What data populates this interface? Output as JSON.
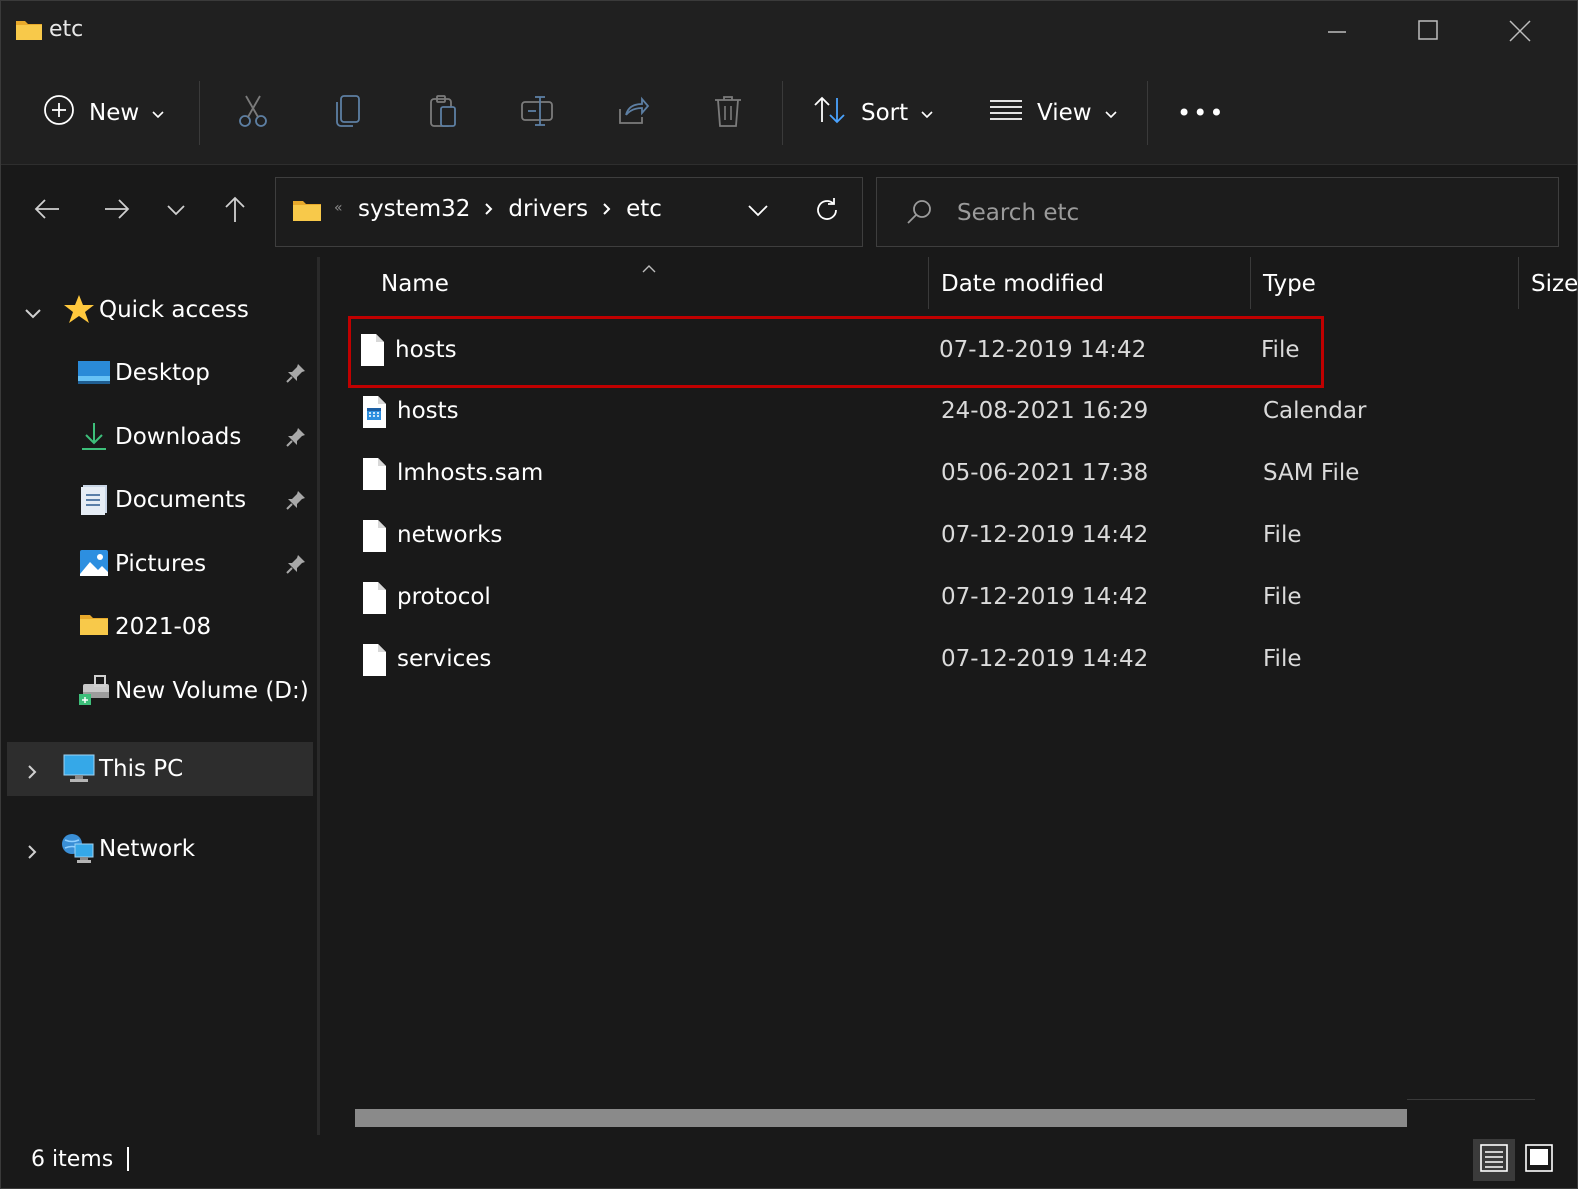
{
  "window": {
    "title": "etc"
  },
  "toolbar": {
    "new_label": "New",
    "sort_label": "Sort",
    "view_label": "View",
    "more_label": "•••"
  },
  "address": {
    "crumbs": [
      "system32",
      "drivers",
      "etc"
    ],
    "overflow_marker": "«"
  },
  "search": {
    "placeholder": "Search etc"
  },
  "sidebar": {
    "items": [
      {
        "label": "Quick access",
        "icon": "star-icon",
        "expanded": true
      },
      {
        "label": "Desktop",
        "icon": "desktop-icon",
        "pinned": true
      },
      {
        "label": "Downloads",
        "icon": "download-icon",
        "pinned": true
      },
      {
        "label": "Documents",
        "icon": "documents-icon",
        "pinned": true
      },
      {
        "label": "Pictures",
        "icon": "pictures-icon",
        "pinned": true
      },
      {
        "label": "2021-08",
        "icon": "folder-icon",
        "pinned": false
      },
      {
        "label": "New Volume (D:)",
        "icon": "drive-icon",
        "pinned": false
      },
      {
        "label": "This PC",
        "icon": "computer-icon",
        "selected": true
      },
      {
        "label": "Network",
        "icon": "network-icon"
      }
    ]
  },
  "columns": {
    "name": "Name",
    "date": "Date modified",
    "type": "Type",
    "size": "Size"
  },
  "files": [
    {
      "name": "hosts",
      "date": "07-12-2019 14:42",
      "type": "File",
      "icon": "file-icon",
      "highlighted": true
    },
    {
      "name": "hosts",
      "date": "24-08-2021 16:29",
      "type": "Calendar",
      "icon": "calendar-file-icon"
    },
    {
      "name": "lmhosts.sam",
      "date": "05-06-2021 17:38",
      "type": "SAM File",
      "icon": "file-icon"
    },
    {
      "name": "networks",
      "date": "07-12-2019 14:42",
      "type": "File",
      "icon": "file-icon"
    },
    {
      "name": "protocol",
      "date": "07-12-2019 14:42",
      "type": "File",
      "icon": "file-icon"
    },
    {
      "name": "services",
      "date": "07-12-2019 14:42",
      "type": "File",
      "icon": "file-icon"
    }
  ],
  "status": {
    "items_text": "6 items"
  },
  "colors": {
    "highlight_border": "#c00000",
    "folder_yellow": "#f5c542",
    "accent_blue": "#4aa3ff"
  }
}
